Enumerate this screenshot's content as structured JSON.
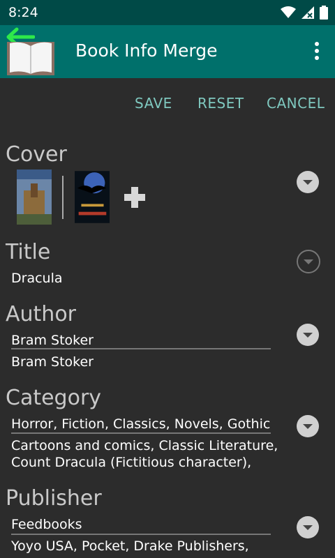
{
  "status": {
    "time": "8:24"
  },
  "appbar": {
    "title": "Book Info Merge"
  },
  "actions": {
    "save": "SAVE",
    "reset": "RESET",
    "cancel": "CANCEL"
  },
  "sections": {
    "cover": {
      "label": "Cover"
    },
    "title": {
      "label": "Title",
      "value": "Dracula"
    },
    "author": {
      "label": "Author",
      "value1": "Bram Stoker",
      "value2": "Bram Stoker"
    },
    "category": {
      "label": "Category",
      "value1": "Horror, Fiction, Classics, Novels, Gothic",
      "value2_line1": "Cartoons and comics, Classic Literature,",
      "value2_line2": "Count Dracula (Fictitious character),"
    },
    "publisher": {
      "label": "Publisher",
      "value1": "Feedbooks",
      "value2_line1": "Yoyo USA, Pocket, Drake Publishers,"
    }
  },
  "colors": {
    "statusbar": "#004a47",
    "appbar": "#00706b",
    "accent": "#7fc8bf",
    "background": "#2c2c2c",
    "back_arrow": "#2ee84a"
  }
}
